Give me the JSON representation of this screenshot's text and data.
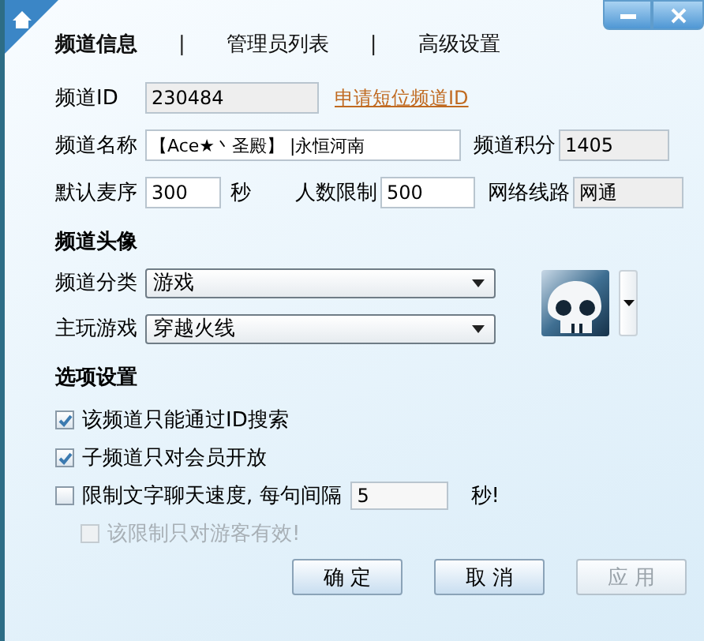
{
  "tabs": [
    {
      "label": "频道信息",
      "selected": true
    },
    {
      "label": "管理员列表",
      "selected": false
    },
    {
      "label": "高级设置",
      "selected": false
    }
  ],
  "tab_separators": [
    "|",
    "|"
  ],
  "rows": [
    {
      "fields": [
        {
          "label": "频道ID",
          "value": "230484",
          "readonly": true
        }
      ],
      "link": "申请短位频道ID"
    },
    {
      "fields": [
        {
          "label": "频道名称",
          "value": "【Ace★丶圣殿】 |永恒河南",
          "readonly": false
        },
        {
          "label": "频道积分",
          "value": "1405",
          "readonly": true
        }
      ]
    },
    {
      "fields": [
        {
          "label": "默认麦序",
          "value": "300",
          "readonly": false,
          "unit": "秒"
        },
        {
          "label": "人数限制",
          "value": "500",
          "readonly": false
        },
        {
          "label": "网络线路",
          "value": "网通",
          "readonly": true
        }
      ]
    }
  ],
  "avatar_section": {
    "title": "频道头像",
    "selects": [
      {
        "label": "频道分类",
        "value": "游戏"
      },
      {
        "label": "主玩游戏",
        "value": "穿越火线"
      }
    ]
  },
  "options": {
    "title": "选项设置",
    "items": [
      {
        "label": "该频道只能通过ID搜索",
        "checked": true,
        "disabled": false
      },
      {
        "label": "子频道只对会员开放",
        "checked": true,
        "disabled": false
      },
      {
        "label": "限制文字聊天速度, 每句间隔",
        "checked": false,
        "disabled": false,
        "value": "5",
        "suffix": "秒!",
        "children": [
          {
            "label": "该限制只对游客有效!",
            "checked": false,
            "disabled": true
          }
        ]
      }
    ]
  },
  "buttons": [
    {
      "label": "确 定",
      "disabled": false
    },
    {
      "label": "取 消",
      "disabled": false
    },
    {
      "label": "应 用",
      "disabled": true
    }
  ]
}
